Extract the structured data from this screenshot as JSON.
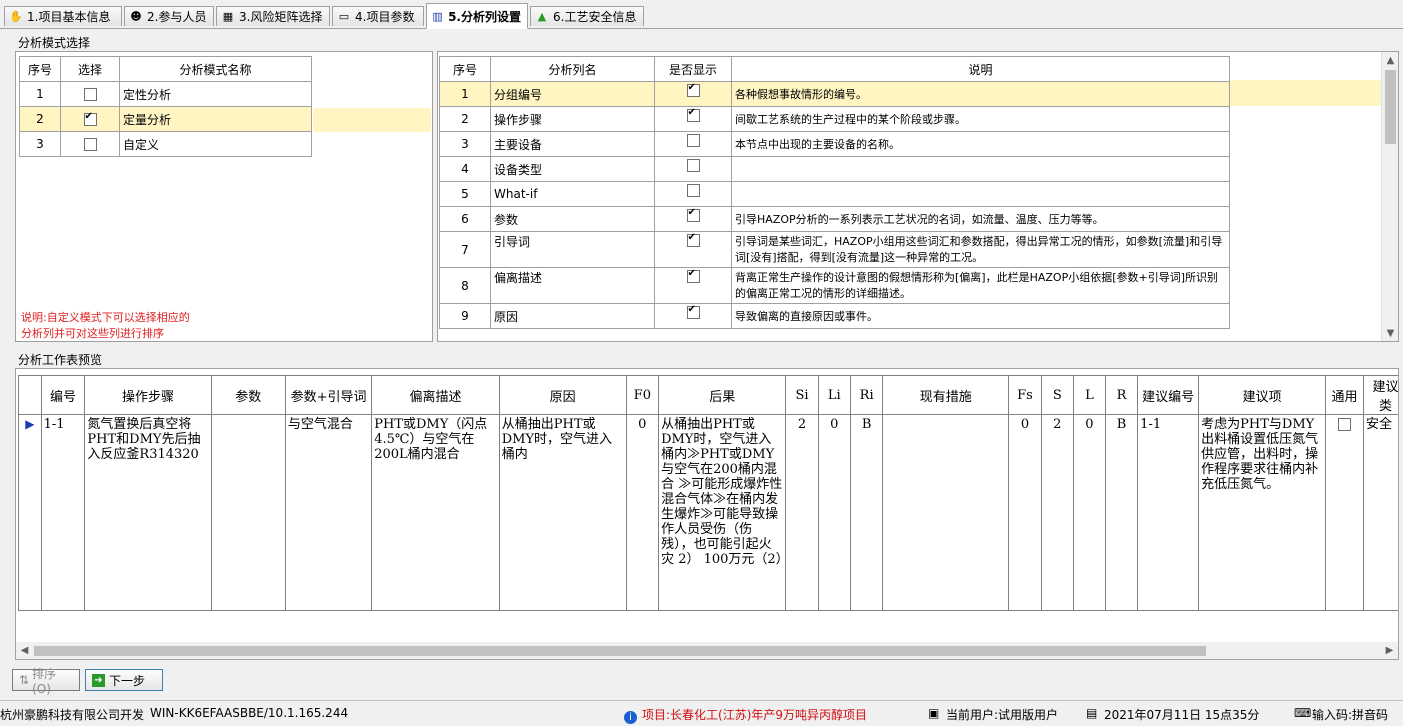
{
  "tabs": [
    {
      "label": "1.项目基本信息",
      "icon": "hand-icon"
    },
    {
      "label": "2.参与人员",
      "icon": "people-icon"
    },
    {
      "label": "3.风险矩阵选择",
      "icon": "matrix-icon"
    },
    {
      "label": "4.项目参数",
      "icon": "params-icon"
    },
    {
      "label": "5.分析列设置",
      "icon": "columns-icon"
    },
    {
      "label": "6.工艺安全信息",
      "icon": "flask-icon"
    }
  ],
  "mode_section": {
    "title": "分析模式选择",
    "headers": [
      "序号",
      "选择",
      "分析模式名称"
    ],
    "rows": [
      {
        "no": "1",
        "checked": false,
        "name": "定性分析"
      },
      {
        "no": "2",
        "checked": true,
        "name": "定量分析"
      },
      {
        "no": "3",
        "checked": false,
        "name": "自定义"
      }
    ],
    "note_line1": "说明:自定义模式下可以选择相应的",
    "note_line2": "分析列并可对这些列进行排序"
  },
  "columns_table": {
    "headers": [
      "序号",
      "分析列名",
      "是否显示",
      "说明"
    ],
    "rows": [
      {
        "no": "1",
        "name": "分组编号",
        "show": true,
        "desc": "各种假想事故情形的编号。"
      },
      {
        "no": "2",
        "name": "操作步骤",
        "show": true,
        "desc": "间歇工艺系统的生产过程中的某个阶段或步骤。"
      },
      {
        "no": "3",
        "name": "主要设备",
        "show": false,
        "desc": "本节点中出现的主要设备的名称。"
      },
      {
        "no": "4",
        "name": "设备类型",
        "show": false,
        "desc": ""
      },
      {
        "no": "5",
        "name": "What-if",
        "show": false,
        "desc": ""
      },
      {
        "no": "6",
        "name": "参数",
        "show": true,
        "desc": "引导HAZOP分析的一系列表示工艺状况的名词，如流量、温度、压力等等。"
      },
      {
        "no": "7",
        "name": "引导词",
        "show": true,
        "desc": "引导词是某些词汇，HAZOP小组用这些词汇和参数搭配，得出异常工况的情形，如参数[流量]和引导词[没有]搭配，得到[没有流量]这一种异常的工况。"
      },
      {
        "no": "8",
        "name": "偏离描述",
        "show": true,
        "desc": "背离正常生产操作的设计意图的假想情形称为[偏离]，此栏是HAZOP小组依据[参数+引导词]所识别的偏离正常工况的情形的详细描述。"
      },
      {
        "no": "9",
        "name": "原因",
        "show": true,
        "desc": "导致偏离的直接原因或事件。"
      }
    ]
  },
  "worksheet": {
    "title": "分析工作表预览",
    "headers": [
      "编号",
      "操作步骤",
      "参数",
      "参数+引导词",
      "偏离描述",
      "原因",
      "F0",
      "后果",
      "Si",
      "Li",
      "Ri",
      "现有措施",
      "Fs",
      "S",
      "L",
      "R",
      "建议编号",
      "建议项",
      "通用",
      "建议类"
    ],
    "row": {
      "no": "1-1",
      "step": "氮气置换后真空将PHT和DMY先后抽入反应釜R314320",
      "param": "",
      "param_guide": "与空气混合",
      "deviation": "PHT或DMY（闪点4.5℃）与空气在200L桶内混合",
      "cause": "从桶抽出PHT或DMY时，空气进入桶内",
      "f0": "0",
      "consequence": "从桶抽出PHT或DMY时，空气进入桶内≫PHT或DMY与空气在200桶内混合 ≫可能形成爆炸性混合气体≫在桶内发生爆炸≫可能导致操作人员受伤（伤残），也可能引起火灾 2） 100万元（2）",
      "si": "2",
      "li": "0",
      "ri": "B",
      "measures": "",
      "fs": "0",
      "s": "2",
      "l": "0",
      "r": "B",
      "sug_no": "1-1",
      "suggestion": "考虑为PHT与DMY出料桶设置低压氮气供应管，出料时，操作程序要求往桶内补充低压氮气。",
      "general_checked": false,
      "sug_type": "安全"
    }
  },
  "buttons": {
    "sort": "排序(O)",
    "next": "下一步"
  },
  "status": {
    "company": "杭州豪鹏科技有限公司开发",
    "machine": "WIN-KK6EFAASBBE/10.1.165.244",
    "project": "项目:长春化工(江苏)年产9万吨异丙醇项目",
    "user": "当前用户:试用版用户",
    "datetime": "2021年07月11日 15点35分",
    "ime": "输入码:拼音码"
  },
  "colors": {
    "selected_row": "#fff5c2",
    "note_red": "#e02020",
    "project_red": "#d01010"
  }
}
